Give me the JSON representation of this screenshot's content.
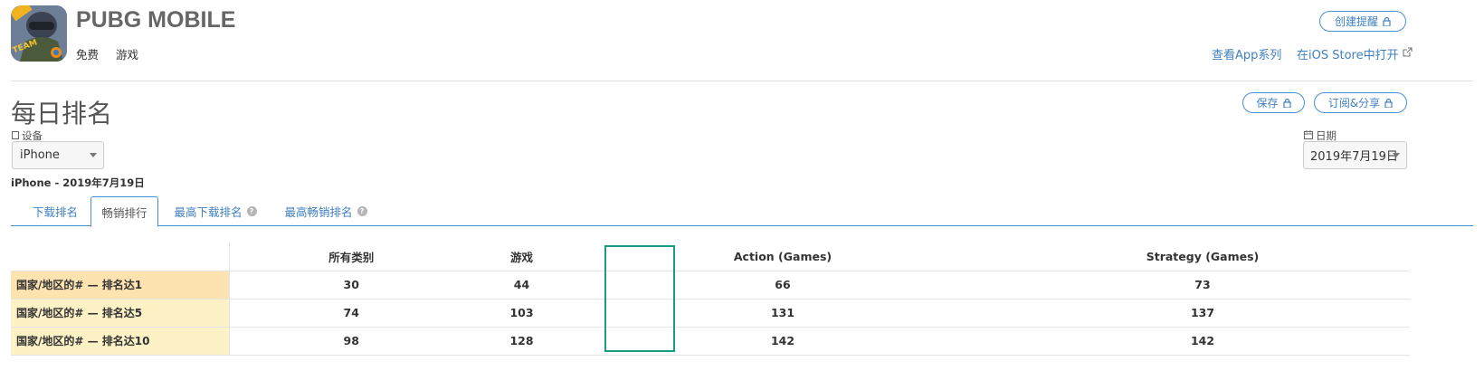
{
  "app": {
    "title": "PUBG MOBILE",
    "price": "免费",
    "category": "游戏",
    "icon": "pubg-app-icon"
  },
  "header_actions": {
    "create_alert": "创建提醒",
    "view_series": "查看App系列",
    "open_ios_store": "在iOS Store中打开"
  },
  "section": {
    "title": "每日排名",
    "save_label": "保存",
    "subscribe_label": "订阅&分享"
  },
  "filters": {
    "device_label": "设备",
    "device_value": "iPhone",
    "date_label": "日期",
    "date_value": "2019年7月19日"
  },
  "subheading": "iPhone - 2019年7月19日",
  "tabs": [
    {
      "label": "下载排名",
      "active": false,
      "help": false
    },
    {
      "label": "畅销排行",
      "active": true,
      "help": false
    },
    {
      "label": "最高下载排名",
      "active": false,
      "help": true
    },
    {
      "label": "最高畅销排名",
      "active": false,
      "help": true
    }
  ],
  "table": {
    "columns": [
      "所有类别",
      "游戏",
      "Action (Games)",
      "Strategy (Games)"
    ],
    "rows": [
      {
        "label": "国家/地区的# — 排名达1",
        "values": [
          "30",
          "44",
          "66",
          "73"
        ]
      },
      {
        "label": "国家/地区的# — 排名达5",
        "values": [
          "74",
          "103",
          "131",
          "137"
        ]
      },
      {
        "label": "国家/地区的# — 排名达10",
        "values": [
          "98",
          "128",
          "142",
          "142"
        ]
      }
    ]
  },
  "colors": {
    "accent": "#3f80c2",
    "highlight": "#1b9a86",
    "row_top": "#fde3b0",
    "row_other": "#fdf2c6"
  }
}
